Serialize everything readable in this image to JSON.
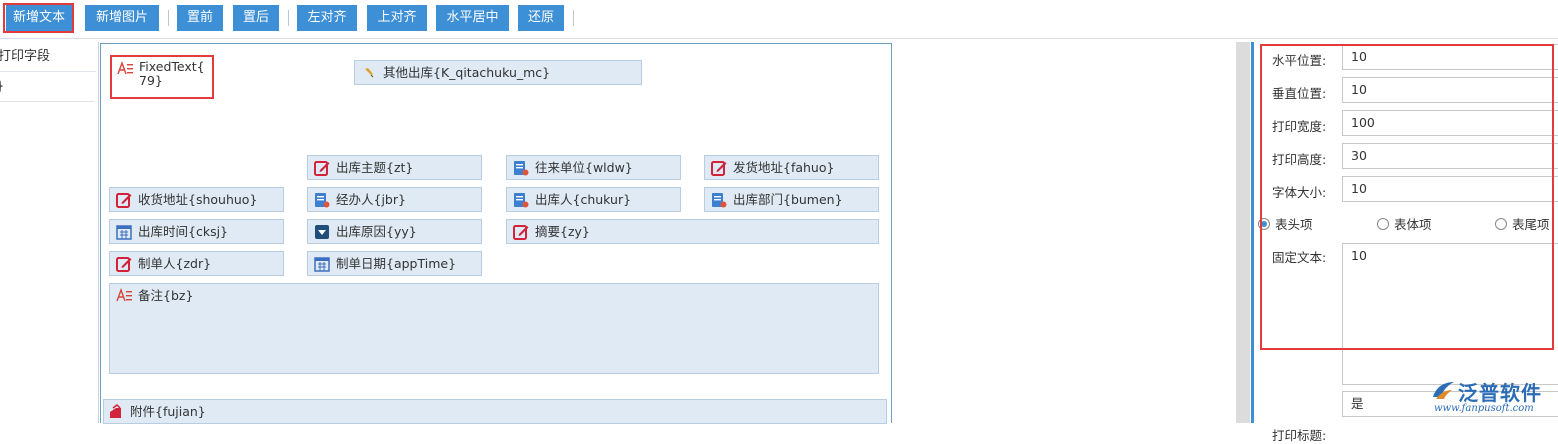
{
  "toolbar": {
    "buttons": [
      "新增文本",
      "新增图片",
      "置前",
      "置后",
      "左对齐",
      "上对齐",
      "水平居中",
      "还原"
    ]
  },
  "left_panel": {
    "rows": [
      "打印字段",
      "}"
    ]
  },
  "canvas": {
    "fixed_text": {
      "line1": "FixedText{",
      "line2": "79}"
    },
    "fields": {
      "qitachuku": "其他出库{K_qitachuku_mc}",
      "zt": "出库主题{zt}",
      "wldw": "往来单位{wldw}",
      "fahuo": "发货地址{fahuo}",
      "shouhuo": "收货地址{shouhuo}",
      "jbr": "经办人{jbr}",
      "chukur": "出库人{chukur}",
      "bumen": "出库部门{bumen}",
      "cksj": "出库时间{cksj}",
      "yy": "出库原因{yy}",
      "zy": "摘要{zy}",
      "zdr": "制单人{zdr}",
      "appTime": "制单日期{appTime}",
      "bz": "备注{bz}",
      "fujian": "附件{fujian}"
    }
  },
  "properties": {
    "x_label": "水平位置:",
    "x_value": "10",
    "y_label": "垂直位置:",
    "y_value": "10",
    "width_label": "打印宽度:",
    "width_value": "100",
    "height_label": "打印高度:",
    "height_value": "30",
    "font_label": "字体大小:",
    "font_value": "10",
    "radio_header": "表头项",
    "radio_body": "表体项",
    "radio_footer": "表尾项",
    "fixed_text_label": "固定文本:",
    "fixed_text_value": "10",
    "print_title_label": "打印标题:",
    "print_title_value": "是"
  },
  "brand": {
    "name": "泛普软件",
    "url": "www.fanpusoft.com"
  },
  "colors": {
    "accent": "#3d8fd6",
    "highlight": "#e33b3b",
    "field_bg": "#dfeaf4"
  },
  "icons": {
    "edit": "edit-icon",
    "user": "user-card-icon",
    "calendar": "calendar-icon",
    "dropdown": "dropdown-icon",
    "text": "text-lines-icon",
    "attach": "attachment-icon",
    "pencil": "pencil-icon"
  }
}
